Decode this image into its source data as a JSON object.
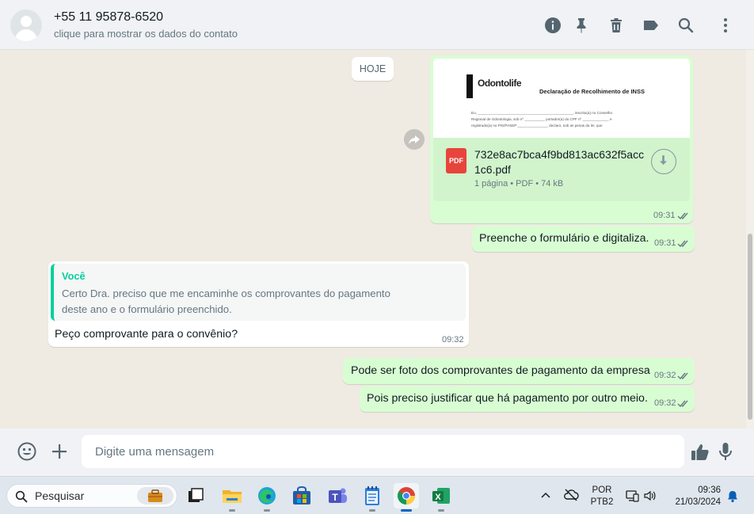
{
  "header": {
    "contact_name": "+55 11 95878-6520",
    "contact_subtitle": "clique para mostrar os dados do contato",
    "icons": [
      "info-icon",
      "pin-icon",
      "trash-icon",
      "label-icon",
      "search-icon",
      "more-menu-icon"
    ]
  },
  "chat": {
    "date_chip": "HOJE",
    "document": {
      "preview_brand": "Odontolife",
      "preview_title": "Declaração de Recolhimento de INSS",
      "preview_line1": "Eu, _______________________________________________, inscrito(a) no Conselho",
      "preview_line2": "Regional de Odontologia, sob nº __________ portador(a) do CPF nº _____________ e",
      "preview_line3": "registrado(a) no PIS/PASEP _______________ declaro, sob as penas da lei, que",
      "file_name": "732e8ac7bca4f9bd813ac632f5acc1c6.pdf",
      "file_meta": "1 página • PDF • 74 kB",
      "pdf_badge": "PDF",
      "time": "09:31"
    },
    "msg_fill_form": {
      "text": "Preenche o formulário e digitaliza.",
      "time": "09:31"
    },
    "msg_reply": {
      "quote_author": "Você",
      "quote_text": "Certo Dra. preciso que me encaminhe os comprovantes do pagamento deste ano e o formulário preenchido.",
      "text": "Peço comprovante para o convênio?",
      "time": "09:32"
    },
    "msg_photo": {
      "text": "Pode ser foto dos comprovantes de pagamento da empresa",
      "time": "09:32"
    },
    "msg_justify": {
      "text": "Pois preciso justificar que há pagamento por outro meio.",
      "time": "09:32"
    }
  },
  "composer": {
    "placeholder": "Digite uma mensagem",
    "icons": [
      "emoji-icon",
      "attach-plus-icon",
      "thumbs-up-icon",
      "microphone-icon"
    ]
  },
  "taskbar": {
    "search_label": "Pesquisar",
    "apps": [
      "briefcase-widget-icon",
      "task-view-icon",
      "file-explorer-icon",
      "edge-icon",
      "store-icon",
      "teams-icon",
      "notepad-icon",
      "chrome-icon",
      "excel-icon"
    ],
    "language_line1": "POR",
    "language_line2": "PTB2",
    "time": "09:36",
    "date": "21/03/2024"
  },
  "colors": {
    "outgoing_bubble": "#d9fdd3",
    "incoming_bubble": "#ffffff",
    "chat_background": "#efeae2",
    "quote_accent": "#06cf9c",
    "read_ticks": "#667781"
  }
}
